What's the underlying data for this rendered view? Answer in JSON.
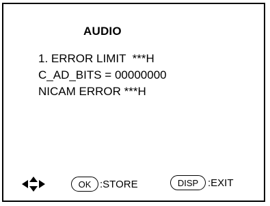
{
  "menu": {
    "title": "AUDIO",
    "lines": [
      "1. ERROR LIMIT  ***H",
      "C_AD_BITS = 00000000",
      "NICAM ERROR ***H"
    ]
  },
  "footer": {
    "navigate_icon": "four-way-arrow-icon",
    "ok_key": "OK",
    "ok_action": ":STORE",
    "disp_key": "DISP",
    "disp_action": ":EXIT"
  },
  "colors": {
    "foreground": "#000000",
    "background": "#ffffff"
  }
}
